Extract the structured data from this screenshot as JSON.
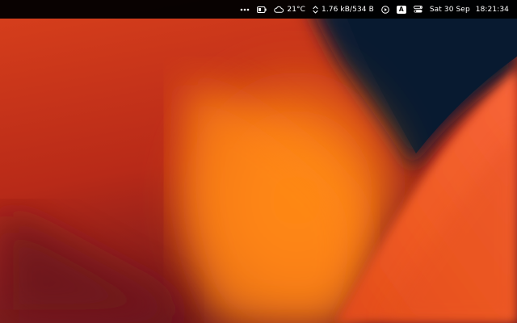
{
  "menubar": {
    "icons": {
      "more": "ellipsis-icon",
      "battery": "battery-icon",
      "weather": "cloud-icon",
      "network": "up-down-arrows-icon",
      "media": "play-circle-icon",
      "control_center": "control-center-icon"
    },
    "temperature": "21°C",
    "network_speed": "1.76 kB/534 B",
    "input_source": "A",
    "date": "Sat 30 Sep",
    "time": "18:21:34"
  },
  "wallpaper": {
    "colors": [
      "#d63a1c",
      "#f27a14",
      "#ff8c10",
      "#7a1a1f",
      "#0b1f36",
      "#f05a2a"
    ]
  }
}
